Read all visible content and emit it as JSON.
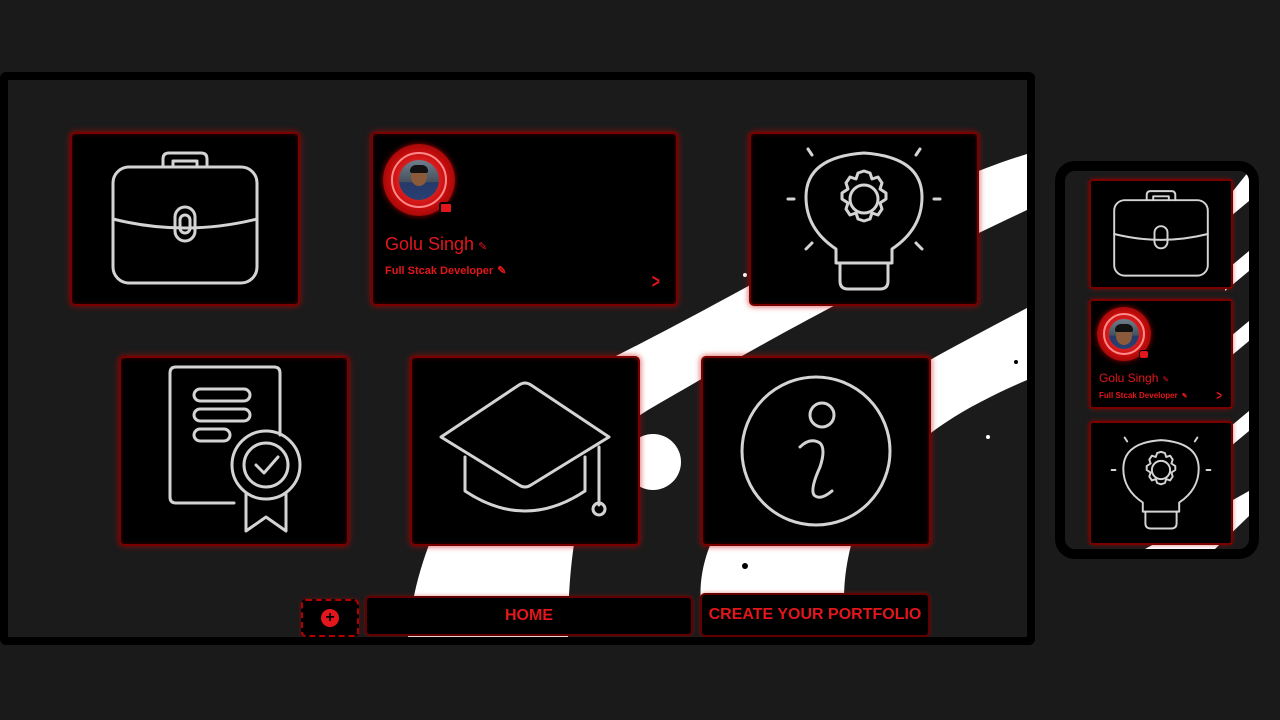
{
  "profile": {
    "name": "Golu Singh",
    "title": "Full Stcak Developer"
  },
  "cards": [
    {
      "icon": "briefcase-icon"
    },
    {
      "icon": "profile-card"
    },
    {
      "icon": "lightbulb-gear-icon"
    },
    {
      "icon": "certificate-icon"
    },
    {
      "icon": "graduation-cap-icon"
    },
    {
      "icon": "info-icon"
    }
  ],
  "bottom_nav": {
    "home_label": "HOME",
    "create_label": "CREATE YOUR PORTFOLIO",
    "add_label": "+"
  },
  "mobile_preview": {
    "name": "Golu Singh",
    "title": "Full Stcak Developer"
  },
  "colors": {
    "background": "#1a1a1a",
    "card_bg": "#000000",
    "accent": "#e3161b",
    "glow": "#7a0000",
    "icon_stroke": "#d4d4d4"
  }
}
